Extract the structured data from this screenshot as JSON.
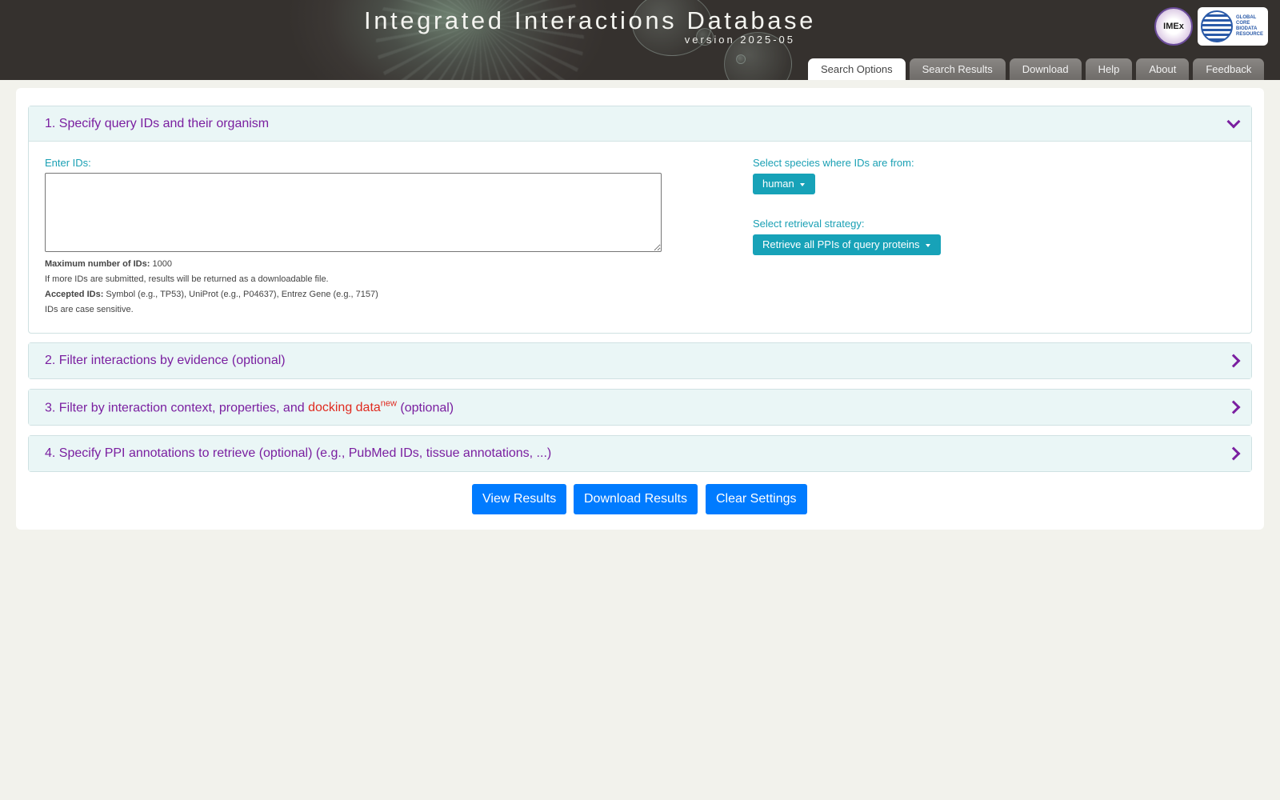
{
  "header": {
    "title": "Integrated Interactions Database",
    "version": "version 2025-05",
    "logos": [
      {
        "name": "imex-logo",
        "text": "IMEx"
      },
      {
        "name": "gcbr-logo",
        "text": "GLOBAL\nCORE\nBIODATA\nRESOURCE"
      }
    ]
  },
  "tabs": [
    {
      "label": "Search Options",
      "active": true
    },
    {
      "label": "Search Results",
      "active": false
    },
    {
      "label": "Download",
      "active": false
    },
    {
      "label": "Help",
      "active": false
    },
    {
      "label": "About",
      "active": false
    },
    {
      "label": "Feedback",
      "active": false
    }
  ],
  "section1": {
    "title": "1. Specify query IDs and their organism",
    "expanded": true,
    "enter_ids_label": "Enter IDs:",
    "ids_value": "",
    "max_label": "Maximum number of IDs:",
    "max_value": "1000",
    "overflow_note": "If more IDs are submitted, results will be returned as a downloadable file.",
    "accepted_label": "Accepted IDs:",
    "accepted_value": "Symbol (e.g., TP53), UniProt (e.g., P04637), Entrez Gene (e.g., 7157)",
    "case_note": "IDs are case sensitive.",
    "species_label": "Select species where IDs are from:",
    "species_value": "human",
    "strategy_label": "Select retrieval strategy:",
    "strategy_value": "Retrieve all PPIs of query proteins"
  },
  "section2": {
    "title": "2. Filter interactions by evidence (optional)",
    "expanded": false
  },
  "section3": {
    "title_prefix": "3. Filter by interaction context, properties, and ",
    "title_highlight": "docking data",
    "title_sup": "new",
    "title_suffix": " (optional)",
    "expanded": false
  },
  "section4": {
    "title": "4. Specify PPI annotations to retrieve (optional) (e.g., PubMed IDs, tissue annotations, ...)",
    "expanded": false
  },
  "buttons": {
    "view": "View Results",
    "download": "Download Results",
    "clear": "Clear Settings"
  },
  "colors": {
    "accent_purple": "#7a1fa0",
    "label_teal": "#1aa0b4",
    "dropdown_teal": "#17a2b8",
    "primary_blue": "#007bff",
    "highlight_red": "#e02a1f"
  }
}
